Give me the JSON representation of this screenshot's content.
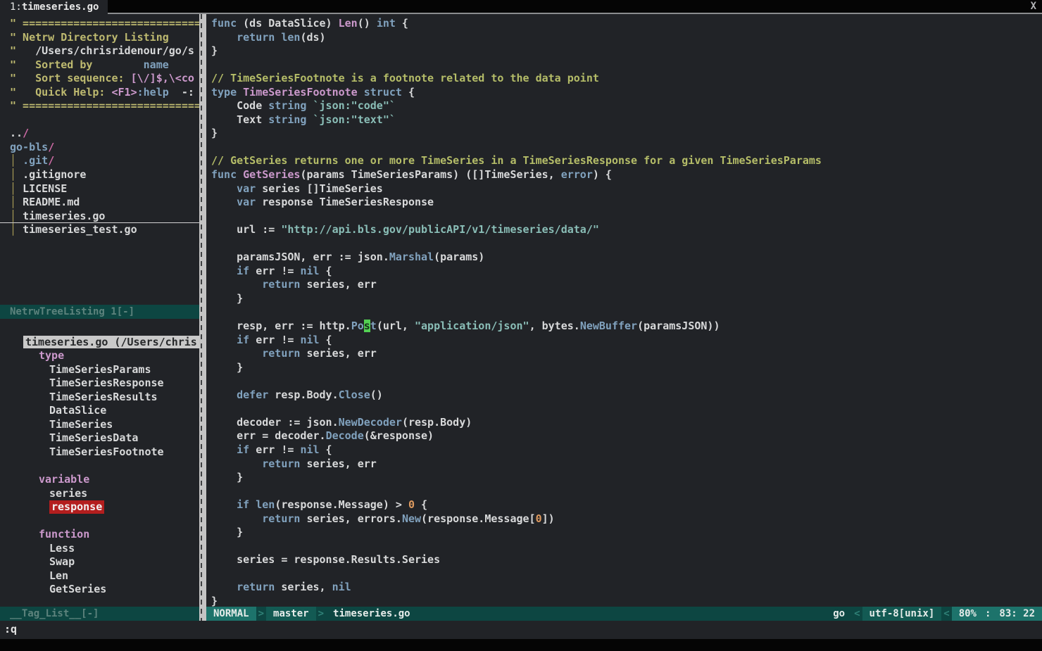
{
  "tabbar": {
    "prefix": "1:",
    "file": "timeseries.go",
    "close": "X"
  },
  "netrw": {
    "status": "NetrwTreeListing 1[-]",
    "lines": [
      {
        "segs": [
          {
            "c": "nh",
            "t": "\" ================================"
          }
        ]
      },
      {
        "segs": [
          {
            "c": "nh",
            "t": "\" Netrw Directory Listing"
          }
        ]
      },
      {
        "segs": [
          {
            "c": "nh",
            "t": "\"   "
          },
          {
            "c": "fg",
            "t": "/Users/chrisridenour/go/s"
          }
        ]
      },
      {
        "segs": [
          {
            "c": "nh",
            "t": "\"   Sorted by        "
          },
          {
            "c": "blue",
            "t": "name"
          }
        ]
      },
      {
        "segs": [
          {
            "c": "nh",
            "t": "\"   Sort sequence: "
          },
          {
            "c": "pink",
            "t": "[\\/]$,\\<co"
          }
        ]
      },
      {
        "segs": [
          {
            "c": "nh",
            "t": "\"   Quick Help: "
          },
          {
            "c": "pink",
            "t": "<F1>"
          },
          {
            "c": "blue",
            "t": ":help"
          },
          {
            "c": "fg",
            "t": "  -:"
          }
        ]
      },
      {
        "segs": [
          {
            "c": "nh",
            "t": "\" ================================"
          }
        ]
      },
      {
        "segs": []
      },
      {
        "segs": [
          {
            "c": "fg",
            "t": ".."
          },
          {
            "c": "slash",
            "t": "/"
          }
        ]
      },
      {
        "segs": [
          {
            "c": "blue",
            "t": "go-bls"
          },
          {
            "c": "slash",
            "t": "/"
          }
        ]
      },
      {
        "segs": [
          {
            "c": "bar",
            "t": "│ "
          },
          {
            "c": "blue",
            "t": ".git"
          },
          {
            "c": "slash",
            "t": "/"
          }
        ]
      },
      {
        "segs": [
          {
            "c": "bar",
            "t": "│ "
          },
          {
            "c": "fg",
            "t": ".gitignore"
          }
        ]
      },
      {
        "segs": [
          {
            "c": "bar",
            "t": "│ "
          },
          {
            "c": "fg",
            "t": "LICENSE"
          }
        ]
      },
      {
        "segs": [
          {
            "c": "bar",
            "t": "│ "
          },
          {
            "c": "fg",
            "t": "README.md"
          }
        ]
      },
      {
        "segs": [
          {
            "c": "bar",
            "t": "│ "
          },
          {
            "c": "fg",
            "t": "timeseries.go"
          }
        ],
        "underline": true
      },
      {
        "segs": [
          {
            "c": "bar",
            "t": "│ "
          },
          {
            "c": "fg",
            "t": "timeseries_test.go"
          }
        ]
      }
    ]
  },
  "tagbar": {
    "status": "__Tag_List__[-]",
    "rows": [
      {
        "kind": "blank",
        "text": ""
      },
      {
        "kind": "file",
        "text": "timeseries.go (/Users/chris"
      },
      {
        "kind": "section",
        "text": "type"
      },
      {
        "kind": "tag",
        "text": "TimeSeriesParams"
      },
      {
        "kind": "tag",
        "text": "TimeSeriesResponse"
      },
      {
        "kind": "tag",
        "text": "TimeSeriesResults"
      },
      {
        "kind": "tag",
        "text": "DataSlice"
      },
      {
        "kind": "tag",
        "text": "TimeSeries"
      },
      {
        "kind": "tag",
        "text": "TimeSeriesData"
      },
      {
        "kind": "tag",
        "text": "TimeSeriesFootnote"
      },
      {
        "kind": "blank",
        "text": ""
      },
      {
        "kind": "section",
        "text": "variable"
      },
      {
        "kind": "tag",
        "text": "series"
      },
      {
        "kind": "tag",
        "text": "response",
        "highlight": true
      },
      {
        "kind": "blank",
        "text": ""
      },
      {
        "kind": "section",
        "text": "function"
      },
      {
        "kind": "tag",
        "text": "Less"
      },
      {
        "kind": "tag",
        "text": "Swap"
      },
      {
        "kind": "tag",
        "text": "Len"
      },
      {
        "kind": "tag",
        "text": "GetSeries"
      }
    ]
  },
  "code": {
    "lines": [
      {
        "segs": [
          {
            "c": "kw",
            "t": "func"
          },
          {
            "c": "fg",
            "t": " (ds DataSlice) "
          },
          {
            "c": "fn",
            "t": "Len"
          },
          {
            "c": "fg",
            "t": "() "
          },
          {
            "c": "kw",
            "t": "int"
          },
          {
            "c": "fg",
            "t": " {"
          }
        ]
      },
      {
        "segs": [
          {
            "c": "fg",
            "t": "    "
          },
          {
            "c": "kw",
            "t": "return"
          },
          {
            "c": "fg",
            "t": " "
          },
          {
            "c": "kw",
            "t": "len"
          },
          {
            "c": "fg",
            "t": "(ds)"
          }
        ]
      },
      {
        "segs": [
          {
            "c": "fg",
            "t": "}"
          }
        ]
      },
      {
        "segs": []
      },
      {
        "segs": [
          {
            "c": "com",
            "t": "// TimeSeriesFootnote is a footnote related to the data point"
          }
        ]
      },
      {
        "segs": [
          {
            "c": "kw",
            "t": "type"
          },
          {
            "c": "fg",
            "t": " "
          },
          {
            "c": "fn",
            "t": "TimeSeriesFootnote"
          },
          {
            "c": "fg",
            "t": " "
          },
          {
            "c": "kw",
            "t": "struct"
          },
          {
            "c": "fg",
            "t": " {"
          }
        ]
      },
      {
        "segs": [
          {
            "c": "fg",
            "t": "    Code "
          },
          {
            "c": "kw",
            "t": "string"
          },
          {
            "c": "fg",
            "t": " "
          },
          {
            "c": "str",
            "t": "`json:\"code\"`"
          }
        ]
      },
      {
        "segs": [
          {
            "c": "fg",
            "t": "    Text "
          },
          {
            "c": "kw",
            "t": "string"
          },
          {
            "c": "fg",
            "t": " "
          },
          {
            "c": "str",
            "t": "`json:\"text\"`"
          }
        ]
      },
      {
        "segs": [
          {
            "c": "fg",
            "t": "}"
          }
        ]
      },
      {
        "segs": []
      },
      {
        "segs": [
          {
            "c": "com",
            "t": "// GetSeries returns one or more TimeSeries in a TimeSeriesResponse for a given TimeSeriesParams"
          }
        ]
      },
      {
        "segs": [
          {
            "c": "kw",
            "t": "func"
          },
          {
            "c": "fg",
            "t": " "
          },
          {
            "c": "fn",
            "t": "GetSeries"
          },
          {
            "c": "fg",
            "t": "(params TimeSeriesParams) ([]TimeSeries, "
          },
          {
            "c": "kw",
            "t": "error"
          },
          {
            "c": "fg",
            "t": ") {"
          }
        ]
      },
      {
        "segs": [
          {
            "c": "fg",
            "t": "    "
          },
          {
            "c": "kw",
            "t": "var"
          },
          {
            "c": "fg",
            "t": " series []TimeSeries"
          }
        ]
      },
      {
        "segs": [
          {
            "c": "fg",
            "t": "    "
          },
          {
            "c": "kw",
            "t": "var"
          },
          {
            "c": "fg",
            "t": " response TimeSeriesResponse"
          }
        ]
      },
      {
        "segs": []
      },
      {
        "segs": [
          {
            "c": "fg",
            "t": "    url := "
          },
          {
            "c": "str",
            "t": "\"http://api.bls.gov/publicAPI/v1/timeseries/data/\""
          }
        ]
      },
      {
        "segs": []
      },
      {
        "segs": [
          {
            "c": "fg",
            "t": "    paramsJSON, err := json."
          },
          {
            "c": "kw",
            "t": "Marshal"
          },
          {
            "c": "fg",
            "t": "(params)"
          }
        ]
      },
      {
        "segs": [
          {
            "c": "fg",
            "t": "    "
          },
          {
            "c": "kw",
            "t": "if"
          },
          {
            "c": "fg",
            "t": " err != "
          },
          {
            "c": "kw",
            "t": "nil"
          },
          {
            "c": "fg",
            "t": " {"
          }
        ]
      },
      {
        "segs": [
          {
            "c": "fg",
            "t": "        "
          },
          {
            "c": "kw",
            "t": "return"
          },
          {
            "c": "fg",
            "t": " series, err"
          }
        ]
      },
      {
        "segs": [
          {
            "c": "fg",
            "t": "    }"
          }
        ]
      },
      {
        "segs": []
      },
      {
        "segs": [
          {
            "c": "fg",
            "t": "    resp, err := http."
          },
          {
            "c": "kw",
            "t": "Po"
          },
          {
            "c": "cursor",
            "t": "s"
          },
          {
            "c": "kw",
            "t": "t"
          },
          {
            "c": "fg",
            "t": "(url, "
          },
          {
            "c": "str",
            "t": "\"application/json\""
          },
          {
            "c": "fg",
            "t": ", bytes."
          },
          {
            "c": "kw",
            "t": "NewBuffer"
          },
          {
            "c": "fg",
            "t": "(paramsJSON))"
          }
        ]
      },
      {
        "segs": [
          {
            "c": "fg",
            "t": "    "
          },
          {
            "c": "kw",
            "t": "if"
          },
          {
            "c": "fg",
            "t": " err != "
          },
          {
            "c": "kw",
            "t": "nil"
          },
          {
            "c": "fg",
            "t": " {"
          }
        ]
      },
      {
        "segs": [
          {
            "c": "fg",
            "t": "        "
          },
          {
            "c": "kw",
            "t": "return"
          },
          {
            "c": "fg",
            "t": " series, err"
          }
        ]
      },
      {
        "segs": [
          {
            "c": "fg",
            "t": "    }"
          }
        ]
      },
      {
        "segs": []
      },
      {
        "segs": [
          {
            "c": "fg",
            "t": "    "
          },
          {
            "c": "kw",
            "t": "defer"
          },
          {
            "c": "fg",
            "t": " resp.Body."
          },
          {
            "c": "kw",
            "t": "Close"
          },
          {
            "c": "fg",
            "t": "()"
          }
        ]
      },
      {
        "segs": []
      },
      {
        "segs": [
          {
            "c": "fg",
            "t": "    decoder := json."
          },
          {
            "c": "kw",
            "t": "NewDecoder"
          },
          {
            "c": "fg",
            "t": "(resp.Body)"
          }
        ]
      },
      {
        "segs": [
          {
            "c": "fg",
            "t": "    err = decoder."
          },
          {
            "c": "kw",
            "t": "Decode"
          },
          {
            "c": "fg",
            "t": "(&response)"
          }
        ]
      },
      {
        "segs": [
          {
            "c": "fg",
            "t": "    "
          },
          {
            "c": "kw",
            "t": "if"
          },
          {
            "c": "fg",
            "t": " err != "
          },
          {
            "c": "kw",
            "t": "nil"
          },
          {
            "c": "fg",
            "t": " {"
          }
        ]
      },
      {
        "segs": [
          {
            "c": "fg",
            "t": "        "
          },
          {
            "c": "kw",
            "t": "return"
          },
          {
            "c": "fg",
            "t": " series, err"
          }
        ]
      },
      {
        "segs": [
          {
            "c": "fg",
            "t": "    }"
          }
        ]
      },
      {
        "segs": []
      },
      {
        "segs": [
          {
            "c": "fg",
            "t": "    "
          },
          {
            "c": "kw",
            "t": "if"
          },
          {
            "c": "fg",
            "t": " "
          },
          {
            "c": "kw",
            "t": "len"
          },
          {
            "c": "fg",
            "t": "(response.Message) > "
          },
          {
            "c": "num",
            "t": "0"
          },
          {
            "c": "fg",
            "t": " {"
          }
        ]
      },
      {
        "segs": [
          {
            "c": "fg",
            "t": "        "
          },
          {
            "c": "kw",
            "t": "return"
          },
          {
            "c": "fg",
            "t": " series, errors."
          },
          {
            "c": "kw",
            "t": "New"
          },
          {
            "c": "fg",
            "t": "(response.Message["
          },
          {
            "c": "num",
            "t": "0"
          },
          {
            "c": "fg",
            "t": "])"
          }
        ]
      },
      {
        "segs": [
          {
            "c": "fg",
            "t": "    }"
          }
        ]
      },
      {
        "segs": []
      },
      {
        "segs": [
          {
            "c": "fg",
            "t": "    series = response.Results.Series"
          }
        ]
      },
      {
        "segs": []
      },
      {
        "segs": [
          {
            "c": "fg",
            "t": "    "
          },
          {
            "c": "kw",
            "t": "return"
          },
          {
            "c": "fg",
            "t": " series, "
          },
          {
            "c": "kw",
            "t": "nil"
          }
        ]
      },
      {
        "segs": [
          {
            "c": "fg",
            "t": "}"
          }
        ]
      }
    ]
  },
  "statusline": {
    "mode": "NORMAL",
    "branch": "master",
    "file": "timeseries.go",
    "filetype": "go",
    "encoding": "utf-8[unix]",
    "percent": "80%",
    "sep": ":",
    "position": "83: 22",
    "chev_right": ">",
    "chev_left": "<"
  },
  "cmdline": {
    "text": ":q"
  },
  "colors": {
    "background": "#212327",
    "status_base": "#0d4642",
    "status_mid": "#135a53",
    "status_bright": "#1d736b",
    "cursor_green": "#53d053",
    "search_red": "#b31e1e",
    "keyword_blue": "#81a2be",
    "func_pink": "#cc99cc",
    "string_cyan": "#8abeb7",
    "comment_khaki": "#b5bd68",
    "number_orange": "#de9a5f",
    "selected_file_gray": "#c9c9c9"
  }
}
